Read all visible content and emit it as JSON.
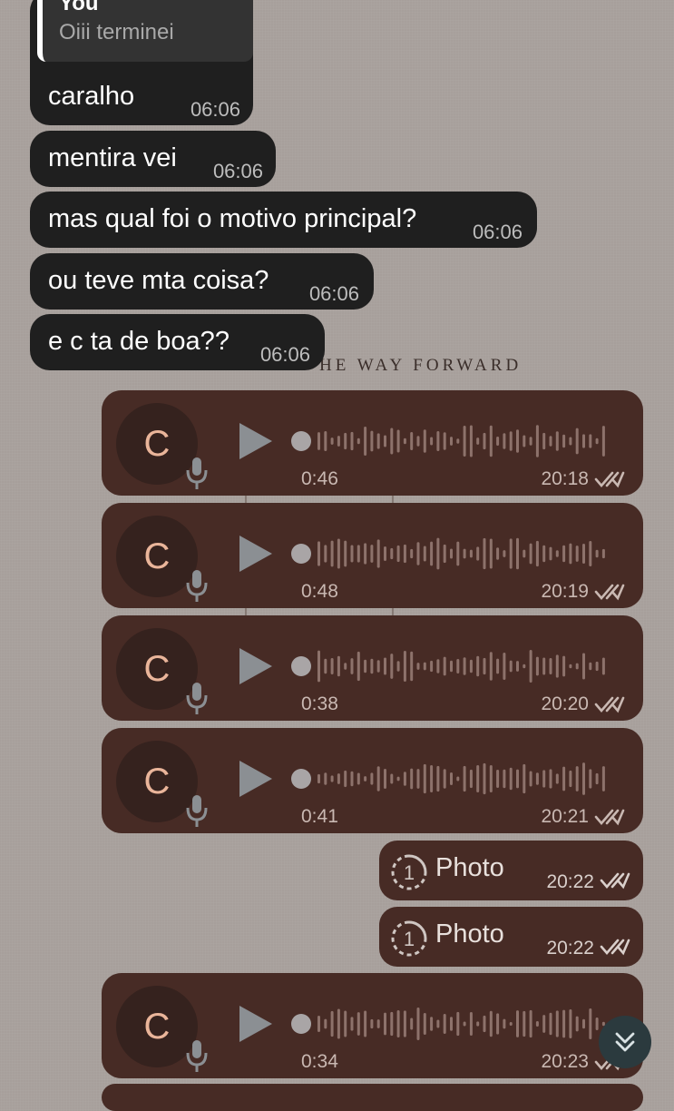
{
  "wallpaper": {
    "text": "HE WAY FORWARD"
  },
  "messages": [
    {
      "text": "caralho",
      "time": "06:06",
      "reply": {
        "author": "You",
        "text": "Oiii terminei"
      }
    },
    {
      "text": "mentira vei",
      "time": "06:06"
    },
    {
      "text": "mas qual foi o motivo principal?",
      "time": "06:06"
    },
    {
      "text": "ou teve mta coisa?",
      "time": "06:06"
    },
    {
      "text": "e c ta de boa??",
      "time": "06:06"
    }
  ],
  "voice_messages": [
    {
      "avatar": "C",
      "duration": "0:46",
      "time": "20:18"
    },
    {
      "avatar": "C",
      "duration": "0:48",
      "time": "20:19"
    },
    {
      "avatar": "C",
      "duration": "0:38",
      "time": "20:20"
    },
    {
      "avatar": "C",
      "duration": "0:41",
      "time": "20:21"
    },
    {
      "avatar": "C",
      "duration": "0:34",
      "time": "20:23"
    }
  ],
  "photos": [
    {
      "label": "Photo",
      "time": "20:22",
      "badge": "1"
    },
    {
      "label": "Photo",
      "time": "20:22",
      "badge": "1"
    }
  ],
  "icons": {
    "play": "play-icon",
    "mic": "mic-icon",
    "read_receipt": "double-check-icon",
    "view_once": "view-once-icon",
    "scroll_down": "double-chevron-down-icon"
  },
  "colors": {
    "incoming_bubble": "#1f1f1f",
    "outgoing_bubble": "#472b25",
    "avatar_letter": "#eab59a"
  }
}
